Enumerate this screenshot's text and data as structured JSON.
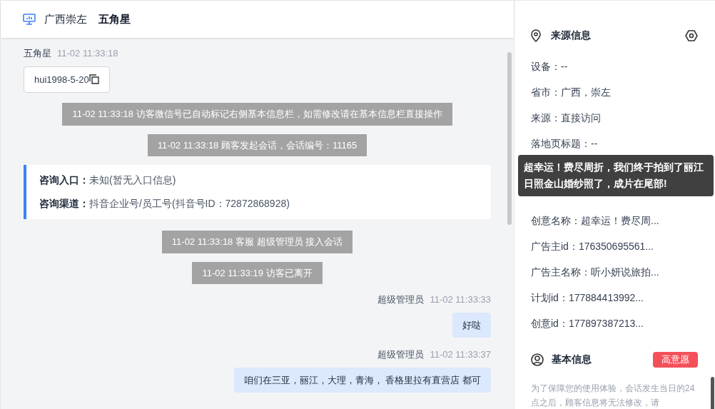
{
  "header": {
    "region": "广西崇左",
    "visitor": "五角星"
  },
  "messages": [
    {
      "kind": "visitor",
      "sender": "五角星",
      "time": "11-02 11:33:18",
      "text": "hui1998-5-20"
    },
    {
      "kind": "notice",
      "text": "11-02 11:33:18 访客微信号已自动标记右侧基本信息栏，如需修改请在基本信息栏直接操作"
    },
    {
      "kind": "notice",
      "text": "11-02 11:33:18 顾客发起会话，会话编号：11165"
    },
    {
      "kind": "card",
      "entries": [
        {
          "label": "咨询入口：",
          "value": "未知(暂无入口信息)"
        },
        {
          "label": "咨询渠道：",
          "value": "抖音企业号/员工号(抖音号ID：72872868928)"
        }
      ]
    },
    {
      "kind": "notice",
      "text": "11-02 11:33:18 客服 超级管理员 接入会话"
    },
    {
      "kind": "notice",
      "text": "11-02 11:33:19 访客已离开"
    },
    {
      "kind": "agent",
      "sender": "超级管理员",
      "time": "11-02 11:33:33",
      "text": "好哒"
    },
    {
      "kind": "agent",
      "sender": "超级管理员",
      "time": "11-02 11:33:37",
      "text": "咱们在三亚，丽江，大理，青海， 香格里拉有直营店 都可"
    }
  ],
  "source_info": {
    "title": "来源信息",
    "rows_before_tooltip": [
      "设备：--",
      "省市：广西，崇左",
      "来源：直接访问",
      "落地页标题：--"
    ],
    "tooltip": "超幸运！费尽周折，我们终于拍到了丽江日照金山婚纱照了，成片在尾部!",
    "rows_after_tooltip": [
      "创意名称：超幸运！费尽周...",
      "广告主id：176350695561...",
      "广告主名称：听小妍说旅拍...",
      "计划id：177884413992...",
      "创意id：177897387213..."
    ]
  },
  "basic_info": {
    "title": "基本信息",
    "tag": "高意愿",
    "note": "为了保障您的使用体验，会话发生当日的24点之后，顾客信息将无法修改，请"
  }
}
